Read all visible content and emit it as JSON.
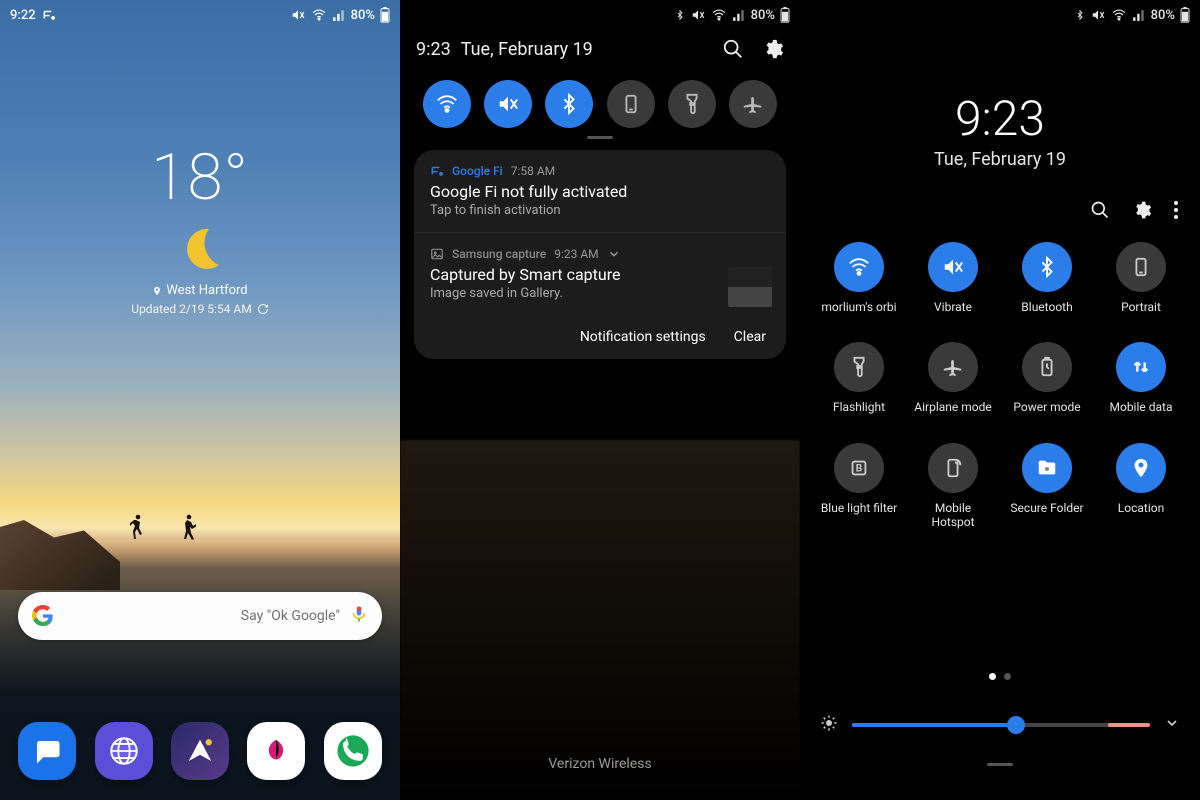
{
  "panel1": {
    "status": {
      "time": "9:22",
      "battery": "80%"
    },
    "weather": {
      "temp": "18°",
      "location": "West Hartford",
      "updated": "Updated 2/19 5:54 AM"
    },
    "search_hint": "Say \"Ok Google\"",
    "dock": [
      "messages",
      "internet",
      "send",
      "gallery",
      "phone"
    ]
  },
  "panel2": {
    "status": {
      "battery": "80%"
    },
    "header": {
      "time": "9:23",
      "date": "Tue, February 19"
    },
    "toggles": [
      {
        "name": "wifi",
        "on": true
      },
      {
        "name": "vibrate",
        "on": true
      },
      {
        "name": "bluetooth",
        "on": true
      },
      {
        "name": "portrait",
        "on": false
      },
      {
        "name": "flashlight",
        "on": false
      },
      {
        "name": "airplane",
        "on": false
      }
    ],
    "notifications": [
      {
        "app": "Google Fi",
        "app_color": "#2b7de9",
        "time": "7:58 AM",
        "title": "Google Fi not fully activated",
        "body": "Tap to finish activation"
      },
      {
        "app": "Samsung capture",
        "app_color": "#8a8a8a",
        "time": "9:23 AM",
        "title": "Captured by Smart capture",
        "body": "Image saved in Gallery.",
        "thumb": true,
        "expand": true
      }
    ],
    "footer": {
      "settings": "Notification settings",
      "clear": "Clear"
    },
    "carrier": "Verizon Wireless"
  },
  "panel3": {
    "status": {
      "battery": "80%"
    },
    "time": "9:23",
    "date": "Tue, February 19",
    "tiles": [
      {
        "name": "wifi",
        "label": "morlium's orbi",
        "on": true
      },
      {
        "name": "vibrate",
        "label": "Vibrate",
        "on": true
      },
      {
        "name": "bluetooth",
        "label": "Bluetooth",
        "on": true
      },
      {
        "name": "portrait",
        "label": "Portrait",
        "on": false
      },
      {
        "name": "flashlight",
        "label": "Flashlight",
        "on": false
      },
      {
        "name": "airplane",
        "label": "Airplane mode",
        "on": false
      },
      {
        "name": "power",
        "label": "Power mode",
        "on": false
      },
      {
        "name": "mobiledata",
        "label": "Mobile data",
        "on": true
      },
      {
        "name": "bluelight",
        "label": "Blue light filter",
        "on": false
      },
      {
        "name": "hotspot",
        "label": "Mobile Hotspot",
        "on": false
      },
      {
        "name": "securefolder",
        "label": "Secure Folder",
        "on": true
      },
      {
        "name": "location",
        "label": "Location",
        "on": true
      }
    ]
  }
}
